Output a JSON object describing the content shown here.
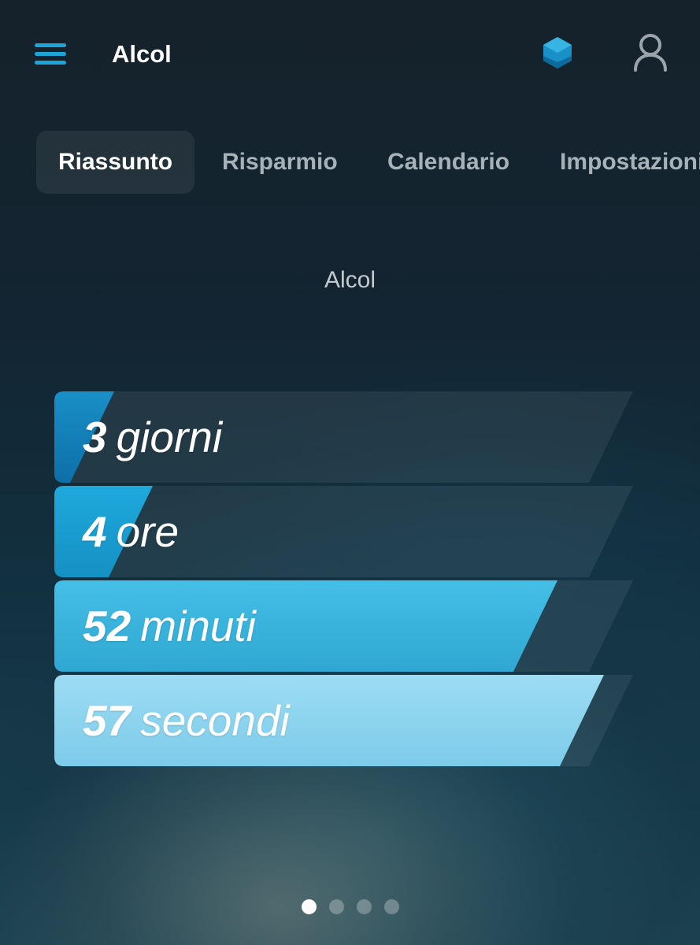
{
  "header": {
    "title": "Alcol",
    "menu_icon": "hamburger-menu-icon",
    "premium_icon": "hexagon-gem-icon",
    "profile_icon": "user-icon"
  },
  "tabs": [
    {
      "label": "Riassunto",
      "active": true
    },
    {
      "label": "Risparmio",
      "active": false
    },
    {
      "label": "Calendario",
      "active": false
    },
    {
      "label": "Impostazioni",
      "active": false
    }
  ],
  "section_title": "Alcol",
  "counters": [
    {
      "value": "3",
      "unit": "giorni",
      "fill": 0.1,
      "color_top": "#1a8fc7",
      "color_bottom": "#0d6fa8"
    },
    {
      "value": "4",
      "unit": "ore",
      "fill": 0.17,
      "color_top": "#1fa9dc",
      "color_bottom": "#1591c4"
    },
    {
      "value": "52",
      "unit": "minuti",
      "fill": 0.87,
      "color_top": "#44bfe6",
      "color_bottom": "#2fa7d2"
    },
    {
      "value": "57",
      "unit": "secondi",
      "fill": 0.95,
      "color_top": "#9ddcf3",
      "color_bottom": "#7ccbea"
    }
  ],
  "pager": {
    "count": 4,
    "active_index": 0
  },
  "colors": {
    "accent": "#1ea4d8",
    "track": "rgba(255,255,255,0.07)"
  }
}
